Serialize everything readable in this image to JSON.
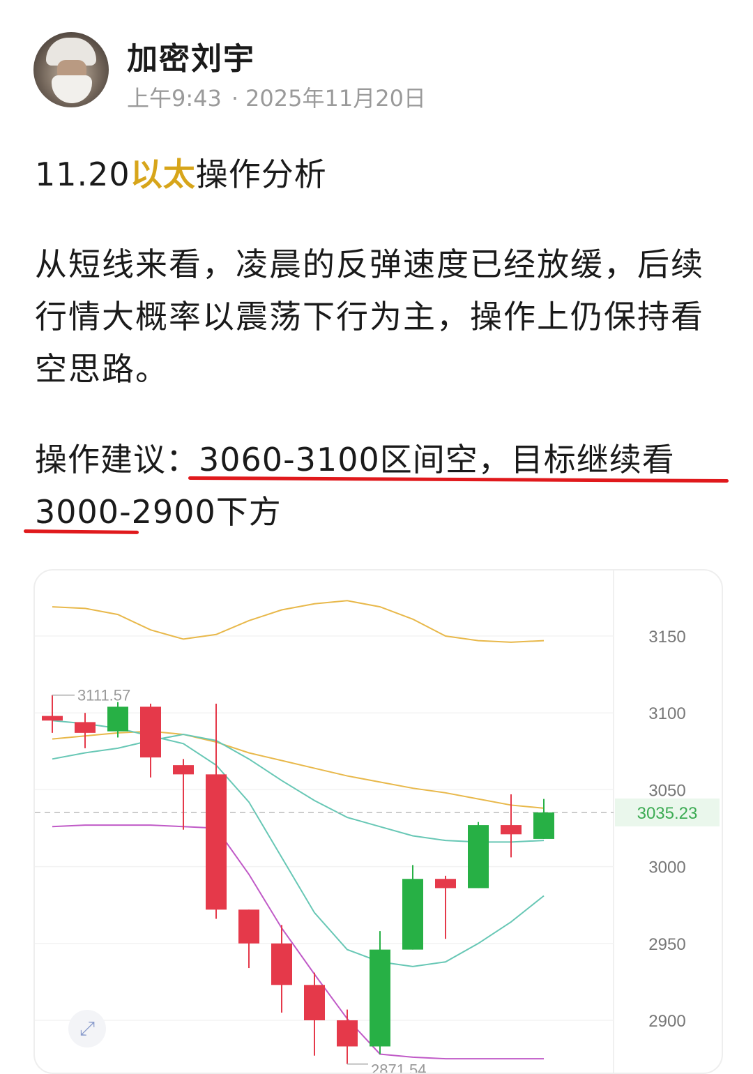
{
  "post": {
    "author": "加密刘宇",
    "time": "上午9:43",
    "date": "2025年11月20日",
    "title_prefix": "11.20",
    "title_highlight": "以太",
    "title_suffix": "操作分析",
    "paragraph": "从短线来看，凌晨的反弹速度已经放缓，后续行情大概率以震荡下行为主，操作上仍保持看空思路。",
    "advice_label": "操作建议：",
    "advice_line1": "3060-3100区间空，目标继续看",
    "advice_line2": "3000-2900下方"
  },
  "chart_data": {
    "type": "candlestick",
    "yticks": [
      3150,
      3100,
      3050,
      3000,
      2950,
      2900
    ],
    "ylim": [
      2870,
      3175
    ],
    "current_price": "3035.23",
    "high_label": "3111.57",
    "low_label": "2871.54",
    "colors": {
      "up": "#27b045",
      "down": "#e5394a",
      "ma_yellow": "#e8b84a",
      "ma_teal": "#67c7b5",
      "ma_purple": "#c05ac7",
      "price_bg": "#eaf7ec",
      "price_text": "#3cab53"
    },
    "candles": [
      {
        "open": 3098,
        "close": 3095,
        "high": 3111.57,
        "low": 3087
      },
      {
        "open": 3094,
        "close": 3087,
        "high": 3100,
        "low": 3077
      },
      {
        "open": 3088,
        "close": 3104,
        "high": 3107,
        "low": 3084
      },
      {
        "open": 3104,
        "close": 3071,
        "high": 3106,
        "low": 3058
      },
      {
        "open": 3066,
        "close": 3060,
        "high": 3070,
        "low": 3024
      },
      {
        "open": 3060,
        "close": 2972,
        "high": 3106,
        "low": 2966
      },
      {
        "open": 2972,
        "close": 2950,
        "high": 2972,
        "low": 2934
      },
      {
        "open": 2950,
        "close": 2923,
        "high": 2962,
        "low": 2905
      },
      {
        "open": 2923,
        "close": 2900,
        "high": 2931,
        "low": 2877
      },
      {
        "open": 2900,
        "close": 2883,
        "high": 2907,
        "low": 2871.54
      },
      {
        "open": 2883,
        "close": 2946,
        "high": 2958,
        "low": 2878
      },
      {
        "open": 2946,
        "close": 2992,
        "high": 3001,
        "low": 2946
      },
      {
        "open": 2992,
        "close": 2986,
        "high": 2994,
        "low": 2953
      },
      {
        "open": 2986,
        "close": 3027,
        "high": 3029,
        "low": 2986
      },
      {
        "open": 3027,
        "close": 3021,
        "high": 3047,
        "low": 3006
      },
      {
        "open": 3018,
        "close": 3035.23,
        "high": 3044,
        "low": 3018
      }
    ],
    "ma_yellow": [
      3169,
      3168,
      3164,
      3154,
      3148,
      3151,
      3160,
      3167,
      3171,
      3173,
      3169,
      3161,
      3150,
      3147,
      3146,
      3147
    ],
    "ma_teal": [
      3070,
      3074,
      3077,
      3082,
      3086,
      3082,
      3070,
      3056,
      3043,
      3032,
      3026,
      3020,
      3017,
      3016,
      3016,
      3017
    ],
    "ma_teal2": [
      3095,
      3093,
      3090,
      3085,
      3080,
      3066,
      3042,
      3006,
      2970,
      2946,
      2938,
      2935,
      2938,
      2950,
      2964,
      2981
    ],
    "ma_yellow2": [
      3083,
      3085,
      3087,
      3088,
      3086,
      3081,
      3074,
      3069,
      3064,
      3059,
      3055,
      3051,
      3048,
      3044,
      3040,
      3038
    ],
    "ma_purple": [
      3026,
      3027,
      3027,
      3027,
      3026,
      3025,
      2995,
      2960,
      2930,
      2901,
      2878,
      2876,
      2875,
      2875,
      2875,
      2875
    ]
  },
  "ui": {
    "expand_icon": "expand-icon"
  }
}
